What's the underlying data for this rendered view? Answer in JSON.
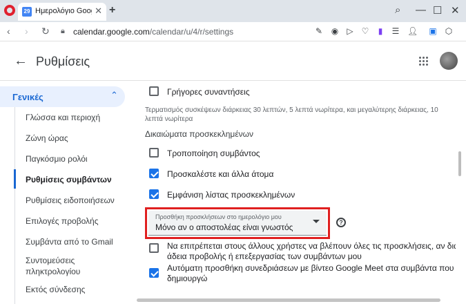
{
  "browser": {
    "tab_title": "Ημερολόγιο Google - Γενικ",
    "tab_favicon_text": "29",
    "url_host": "calendar.google.com",
    "url_path": "/calendar/u/4/r/settings"
  },
  "header": {
    "title": "Ρυθμίσεις"
  },
  "sidebar": {
    "section": "Γενικές",
    "items": [
      {
        "label": "Γλώσσα και περιοχή"
      },
      {
        "label": "Ζώνη ώρας"
      },
      {
        "label": "Παγκόσμιο ρολόι"
      },
      {
        "label": "Ρυθμίσεις συμβάντων"
      },
      {
        "label": "Ρυθμίσεις ειδοποιήσεων"
      },
      {
        "label": "Επιλογές προβολής"
      },
      {
        "label": "Συμβάντα από το Gmail"
      },
      {
        "label": "Συντομεύσεις πληκτρολογίου"
      },
      {
        "label": "Εκτός σύνδεσης"
      }
    ]
  },
  "main": {
    "quick_meetings": {
      "label": "Γρήγορες συναντήσεις",
      "checked": false
    },
    "quick_meetings_hint": "Τερματισμός συσκέψεων διάρκειας 30 λεπτών, 5 λεπτά νωρίτερα, και μεγαλύτερης διάρκειας, 10 λεπτά νωρίτερα",
    "guest_permissions_title": "Δικαιώματα προσκεκλημένων",
    "modify_event": {
      "label": "Τροποποίηση συμβάντος",
      "checked": false
    },
    "invite_others": {
      "label": "Προσκαλέστε και άλλα άτομα",
      "checked": true
    },
    "see_guest_list": {
      "label": "Εμφάνιση λίστας προσκεκλημένων",
      "checked": true
    },
    "add_invitations": {
      "label": "Προσθήκη προσκλήσεων στο ημερολόγιο μου",
      "value": "Μόνο αν ο αποστολέας είναι γνωστός"
    },
    "let_others_see": {
      "line1": "Να επιτρέπεται στους άλλους χρήστες να βλέπουν όλες τις προσκλήσεις, αν διαθέτουν",
      "line2": "άδεια προβολής ή επεξεργασίας των συμβάντων μου",
      "checked": false
    },
    "auto_meet": {
      "line1": "Αυτόματη προσθήκη συνεδριάσεων με βίντεο Google Meet στα συμβάντα που",
      "line2": "δημιουργώ",
      "checked": true
    }
  },
  "colors": {
    "accent": "#1a73e8",
    "highlight_frame": "#e02020",
    "sidebar_active_bg": "#e8f0fe"
  }
}
